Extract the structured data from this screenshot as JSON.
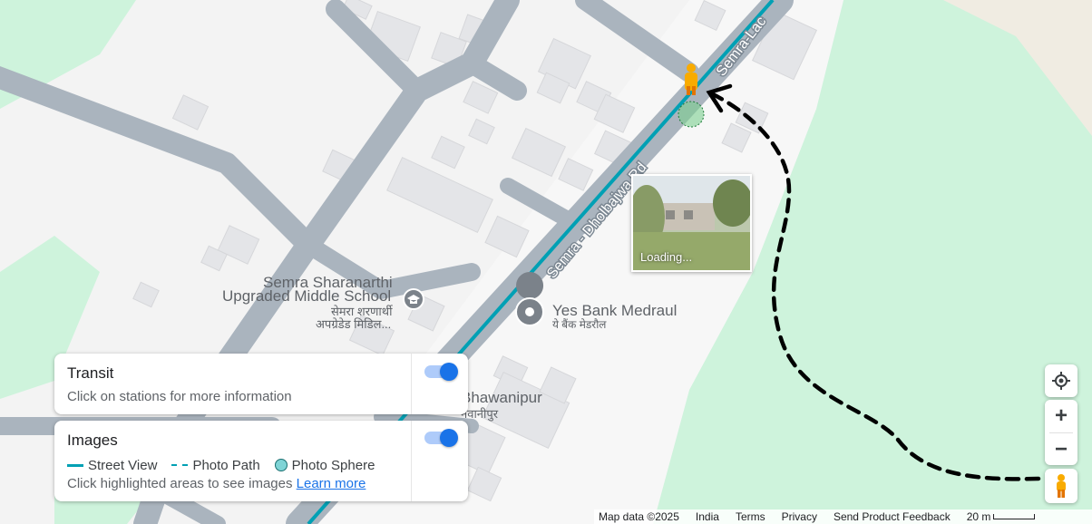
{
  "map": {
    "road_label": "Semra - Dholbajwa Rd",
    "road_label_2": "Semra-Lac",
    "poi_school": {
      "name_line1": "Semra Sharanarthi",
      "name_line2": "Upgraded Middle School",
      "hindi_line1": "सेमरा शरणार्थी",
      "hindi_line2": "अपग्रेडेड मिडिल..."
    },
    "poi_bank": {
      "name": "Yes Bank Medraul",
      "hindi": "ये बैंक मेडरौल"
    },
    "poi_village": {
      "name": "Bhawanipur",
      "hindi": "नवानीपुर"
    },
    "thumbnail_label": "Loading...",
    "colors": {
      "road": "#aab4be",
      "street_view_line": "#00a0b4",
      "park": "#cef3dc",
      "building": "#e4e5e8"
    }
  },
  "transit_card": {
    "title": "Transit",
    "description": "Click on stations for more information",
    "toggle_on": true
  },
  "images_card": {
    "title": "Images",
    "legend_street_view": "Street View",
    "legend_photo_path": "Photo Path",
    "legend_photo_sphere": "Photo Sphere",
    "description": "Click highlighted areas to see images",
    "learn_more": "Learn more",
    "toggle_on": true
  },
  "controls": {
    "my_location_icon": "crosshair-icon",
    "zoom_in": "+",
    "zoom_out": "−",
    "pegman_icon": "pegman-icon"
  },
  "footer": {
    "map_data": "Map data ©2025",
    "country": "India",
    "terms": "Terms",
    "privacy": "Privacy",
    "feedback": "Send Product Feedback",
    "scale": "20 m"
  }
}
